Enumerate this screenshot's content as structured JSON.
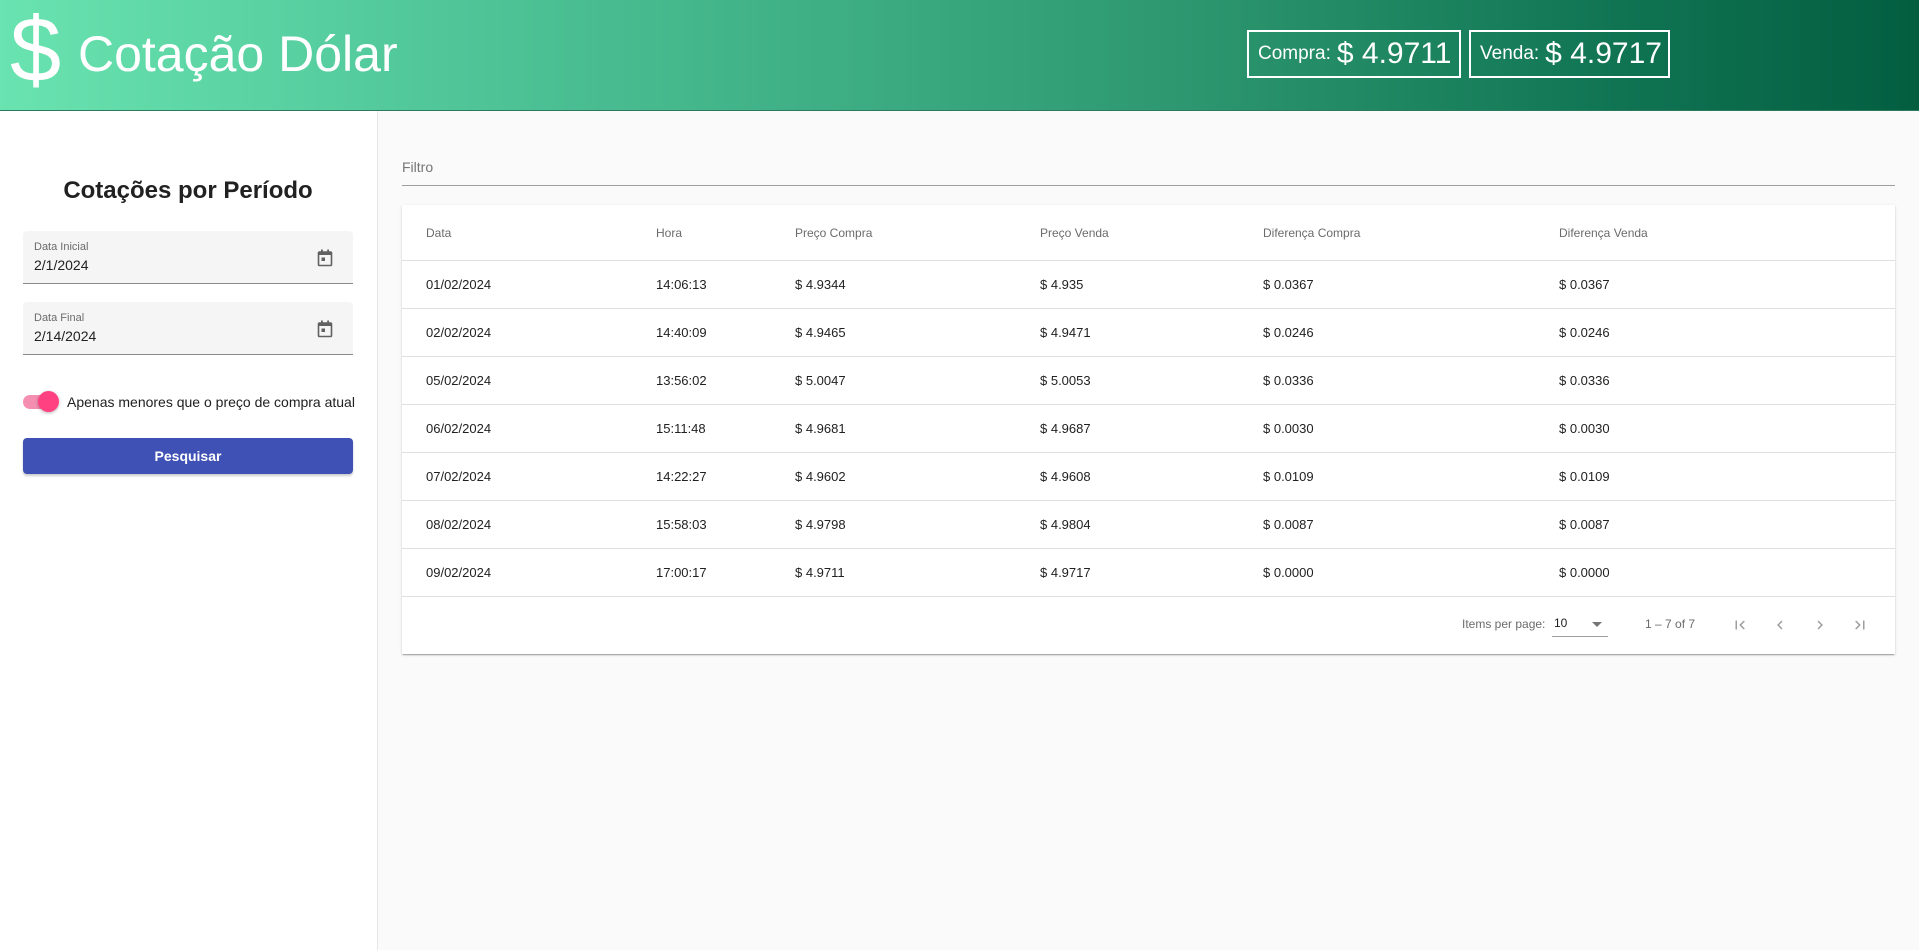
{
  "header": {
    "currency_symbol": "$",
    "title": "Cotação Dólar",
    "buy": {
      "label": "Compra:",
      "value": "$ 4.9711"
    },
    "sell": {
      "label": "Venda:",
      "value": "$ 4.9717"
    }
  },
  "sidebar": {
    "title": "Cotações por Período",
    "start_date": {
      "label": "Data Inicial",
      "value": "2/1/2024"
    },
    "end_date": {
      "label": "Data Final",
      "value": "2/14/2024"
    },
    "toggle_label": "Apenas menores que o preço de compra atual",
    "toggle_on": true,
    "search_label": "Pesquisar"
  },
  "filter": {
    "placeholder": "Filtro"
  },
  "table": {
    "columns": [
      "Data",
      "Hora",
      "Preço Compra",
      "Preço Venda",
      "Diferença Compra",
      "Diferença Venda"
    ],
    "rows": [
      [
        "01/02/2024",
        "14:06:13",
        "$ 4.9344",
        "$ 4.935",
        "$ 0.0367",
        "$ 0.0367"
      ],
      [
        "02/02/2024",
        "14:40:09",
        "$ 4.9465",
        "$ 4.9471",
        "$ 0.0246",
        "$ 0.0246"
      ],
      [
        "05/02/2024",
        "13:56:02",
        "$ 5.0047",
        "$ 5.0053",
        "$ 0.0336",
        "$ 0.0336"
      ],
      [
        "06/02/2024",
        "15:11:48",
        "$ 4.9681",
        "$ 4.9687",
        "$ 0.0030",
        "$ 0.0030"
      ],
      [
        "07/02/2024",
        "14:22:27",
        "$ 4.9602",
        "$ 4.9608",
        "$ 0.0109",
        "$ 0.0109"
      ],
      [
        "08/02/2024",
        "15:58:03",
        "$ 4.9798",
        "$ 4.9804",
        "$ 0.0087",
        "$ 0.0087"
      ],
      [
        "09/02/2024",
        "17:00:17",
        "$ 4.9711",
        "$ 4.9717",
        "$ 0.0000",
        "$ 0.0000"
      ]
    ]
  },
  "paginator": {
    "items_per_page_label": "Items per page:",
    "page_size": "10",
    "range_label": "1 – 7 of 7",
    "icons": [
      "first-page-icon",
      "previous-page-icon",
      "next-page-icon",
      "last-page-icon"
    ]
  },
  "colors": {
    "header_gradient_start": "#69e3b0",
    "header_gradient_end": "#035e40",
    "primary": "#3f51b5",
    "accent": "#ff4081"
  }
}
